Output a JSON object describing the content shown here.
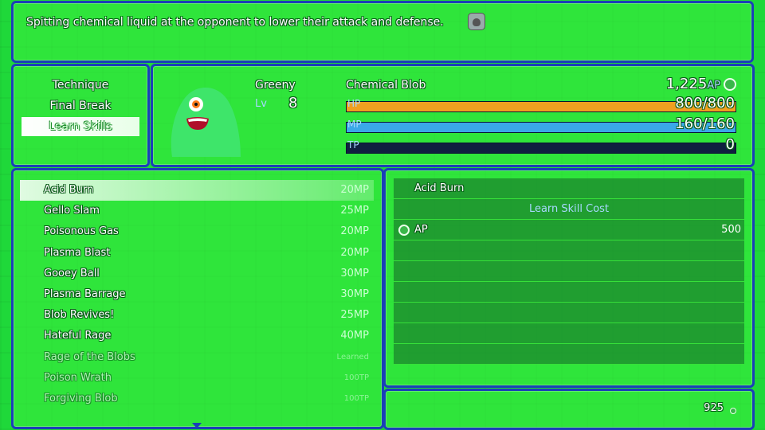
{
  "help": {
    "text": "Spitting chemical liquid at the opponent to lower their attack and defense.",
    "icon": "bag-icon"
  },
  "commands": [
    {
      "label": "Technique",
      "selected": false
    },
    {
      "label": "Final Break",
      "selected": false
    },
    {
      "label": "Learn Skills",
      "selected": true
    }
  ],
  "actor": {
    "name": "Greeny",
    "level_label": "Lv",
    "level": "8",
    "class_name": "Chemical Blob",
    "ap_value": "1,225",
    "ap_unit": "AP",
    "hp_label": "HP",
    "hp_text": "800/800",
    "hp_ratio": 1.0,
    "mp_label": "MP",
    "mp_text": "160/160",
    "mp_ratio": 1.0,
    "tp_label": "TP",
    "tp_text": "0",
    "tp_ratio": 0.0
  },
  "skills": [
    {
      "name": "Acid Burn",
      "cost": "20MP",
      "selected": true,
      "learned": false
    },
    {
      "name": "Gello Slam",
      "cost": "25MP",
      "selected": false,
      "learned": false
    },
    {
      "name": "Poisonous Gas",
      "cost": "20MP",
      "selected": false,
      "learned": false
    },
    {
      "name": "Plasma Blast",
      "cost": "20MP",
      "selected": false,
      "learned": false
    },
    {
      "name": "Gooey Ball",
      "cost": "30MP",
      "selected": false,
      "learned": false
    },
    {
      "name": "Plasma Barrage",
      "cost": "30MP",
      "selected": false,
      "learned": false
    },
    {
      "name": "Blob Revives!",
      "cost": "25MP",
      "selected": false,
      "learned": false
    },
    {
      "name": "Hateful Rage",
      "cost": "40MP",
      "selected": false,
      "learned": false
    },
    {
      "name": "Rage of the Blobs",
      "cost": "Learned",
      "selected": false,
      "learned": true
    },
    {
      "name": "Poison Wrath",
      "cost": "100TP",
      "selected": false,
      "learned": true
    },
    {
      "name": "Forgiving Blob",
      "cost": "100TP",
      "selected": false,
      "learned": true
    }
  ],
  "cost_panel": {
    "skill_name": "Acid Burn",
    "header": "Learn Skill Cost",
    "rows": [
      {
        "label": "AP",
        "value": "500"
      }
    ]
  },
  "gold": {
    "value": "925"
  },
  "colors": {
    "window_border": "#1a3fb8",
    "hp_gauge": "#f0a020",
    "mp_gauge": "#3aa8e8",
    "blob": "#3ee56a"
  }
}
